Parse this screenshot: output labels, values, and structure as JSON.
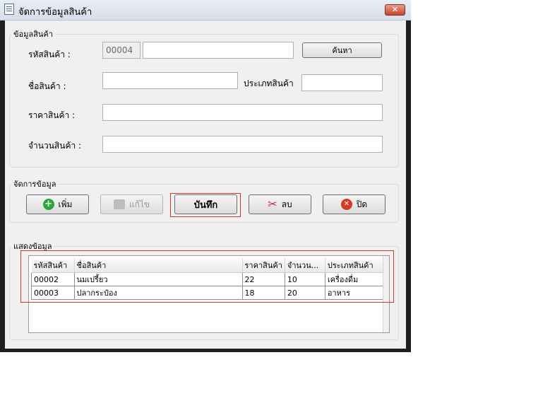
{
  "window": {
    "title": "จัดการข้อมูลสินค้า",
    "close_label": "✕"
  },
  "info_group": {
    "legend": "ข้อมูลสินค้า",
    "code_label": "รหัสสินค้า :",
    "code_value": "00004",
    "code_extra_value": "",
    "search_button": "ค้นหา",
    "name_label": "ชื่อสินค้า :",
    "name_value": "",
    "type_label": "ประเภทสินค้า",
    "type_value": "",
    "price_label": "ราคาสินค้า :",
    "price_value": "",
    "qty_label": "จำนวนสินค้า :",
    "qty_value": ""
  },
  "manage_group": {
    "legend": "จัดการข้อมูล",
    "add_label": "เพิ่ม",
    "edit_label": "แก้ไข",
    "save_label": "บันทึก",
    "delete_label": "ลบ",
    "close_label": "ปิด"
  },
  "display_group": {
    "legend": "แสดงข้อมูล",
    "columns": [
      "รหัสสินค้า",
      "ชื่อสินค้า",
      "ราคาสินค้า",
      "จำนวน...",
      "ประเภทสินค้า"
    ],
    "rows": [
      [
        "00002",
        "นมเปรี้ยว",
        "22",
        "10",
        "เครื่องดื่ม"
      ],
      [
        "00003",
        "ปลากระป๋อง",
        "18",
        "20",
        "อาหาร"
      ]
    ]
  },
  "icons": {
    "add": "plus-circle-icon",
    "edit": "edit-icon",
    "delete": "scissors-icon",
    "close": "x-circle-icon"
  },
  "colors": {
    "highlight_border": "#d0342c",
    "add_green": "#2aa63a",
    "close_red": "#d63a26"
  }
}
